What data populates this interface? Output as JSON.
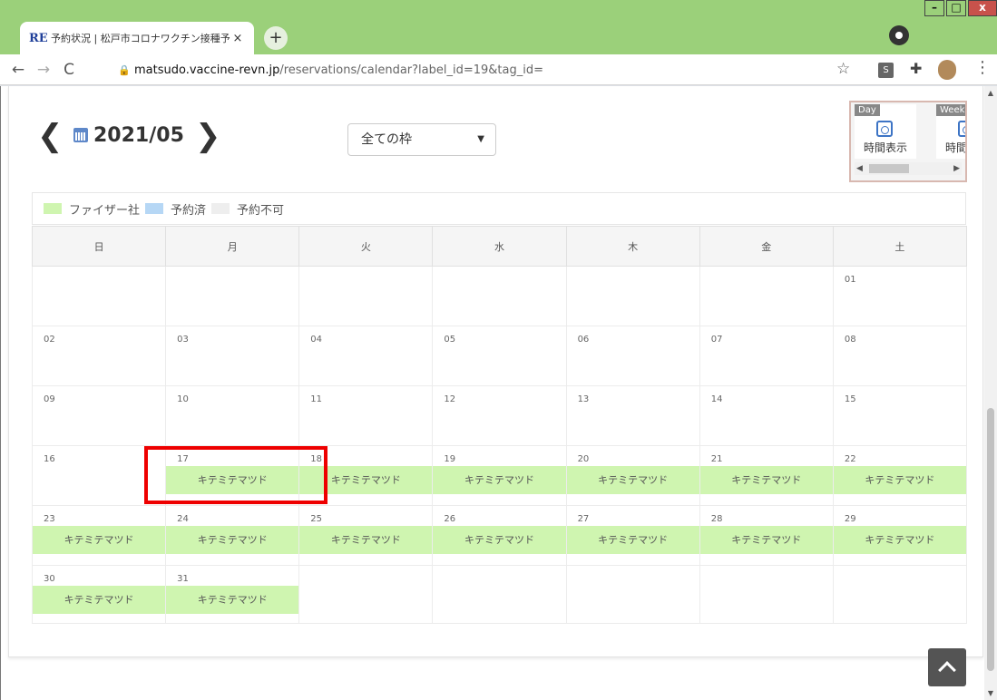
{
  "browser": {
    "tab_title": "予約状況 | 松戸市コロナワクチン接種予",
    "favicon_text": "RE",
    "tab_close_glyph": "×",
    "new_tab_glyph": "+",
    "url_host": "matsudo.vaccine-revn.jp",
    "url_path": "/reservations/calendar?label_id=19&tag_id=",
    "extension_label": "S"
  },
  "calendar_header": {
    "month": "2021/05",
    "prev_glyph": "❮",
    "next_glyph": "❯"
  },
  "filter": {
    "selected": "全ての枠"
  },
  "view_switch": {
    "day_badge": "Day",
    "week_badge": "Week",
    "day_label": "時間表示",
    "week_label": "時間表示"
  },
  "legend": [
    {
      "label": "ファイザー社",
      "color": "#cff5b0"
    },
    {
      "label": "予約済",
      "color": "#b6d7f5"
    },
    {
      "label": "予約不可",
      "color": "#eeeeee"
    }
  ],
  "weekdays": [
    "日",
    "月",
    "火",
    "水",
    "木",
    "金",
    "土"
  ],
  "weeks": [
    [
      {
        "day": "",
        "event": ""
      },
      {
        "day": "",
        "event": ""
      },
      {
        "day": "",
        "event": ""
      },
      {
        "day": "",
        "event": ""
      },
      {
        "day": "",
        "event": ""
      },
      {
        "day": "",
        "event": ""
      },
      {
        "day": "01",
        "event": ""
      }
    ],
    [
      {
        "day": "02",
        "event": ""
      },
      {
        "day": "03",
        "event": ""
      },
      {
        "day": "04",
        "event": ""
      },
      {
        "day": "05",
        "event": ""
      },
      {
        "day": "06",
        "event": ""
      },
      {
        "day": "07",
        "event": ""
      },
      {
        "day": "08",
        "event": ""
      }
    ],
    [
      {
        "day": "09",
        "event": ""
      },
      {
        "day": "10",
        "event": ""
      },
      {
        "day": "11",
        "event": ""
      },
      {
        "day": "12",
        "event": ""
      },
      {
        "day": "13",
        "event": ""
      },
      {
        "day": "14",
        "event": ""
      },
      {
        "day": "15",
        "event": ""
      }
    ],
    [
      {
        "day": "16",
        "event": ""
      },
      {
        "day": "17",
        "event": "キテミテマツド"
      },
      {
        "day": "18",
        "event": "キテミテマツド"
      },
      {
        "day": "19",
        "event": "キテミテマツド"
      },
      {
        "day": "20",
        "event": "キテミテマツド"
      },
      {
        "day": "21",
        "event": "キテミテマツド"
      },
      {
        "day": "22",
        "event": "キテミテマツド"
      }
    ],
    [
      {
        "day": "23",
        "event": "キテミテマツド"
      },
      {
        "day": "24",
        "event": "キテミテマツド"
      },
      {
        "day": "25",
        "event": "キテミテマツド"
      },
      {
        "day": "26",
        "event": "キテミテマツド"
      },
      {
        "day": "27",
        "event": "キテミテマツド"
      },
      {
        "day": "28",
        "event": "キテミテマツド"
      },
      {
        "day": "29",
        "event": "キテミテマツド"
      }
    ],
    [
      {
        "day": "30",
        "event": "キテミテマツド"
      },
      {
        "day": "31",
        "event": "キテミテマツド"
      },
      {
        "day": "",
        "event": ""
      },
      {
        "day": "",
        "event": ""
      },
      {
        "day": "",
        "event": ""
      },
      {
        "day": "",
        "event": ""
      },
      {
        "day": "",
        "event": ""
      }
    ]
  ],
  "colors": {
    "available_event": "#cff5b0",
    "highlight": "#ee0000"
  }
}
